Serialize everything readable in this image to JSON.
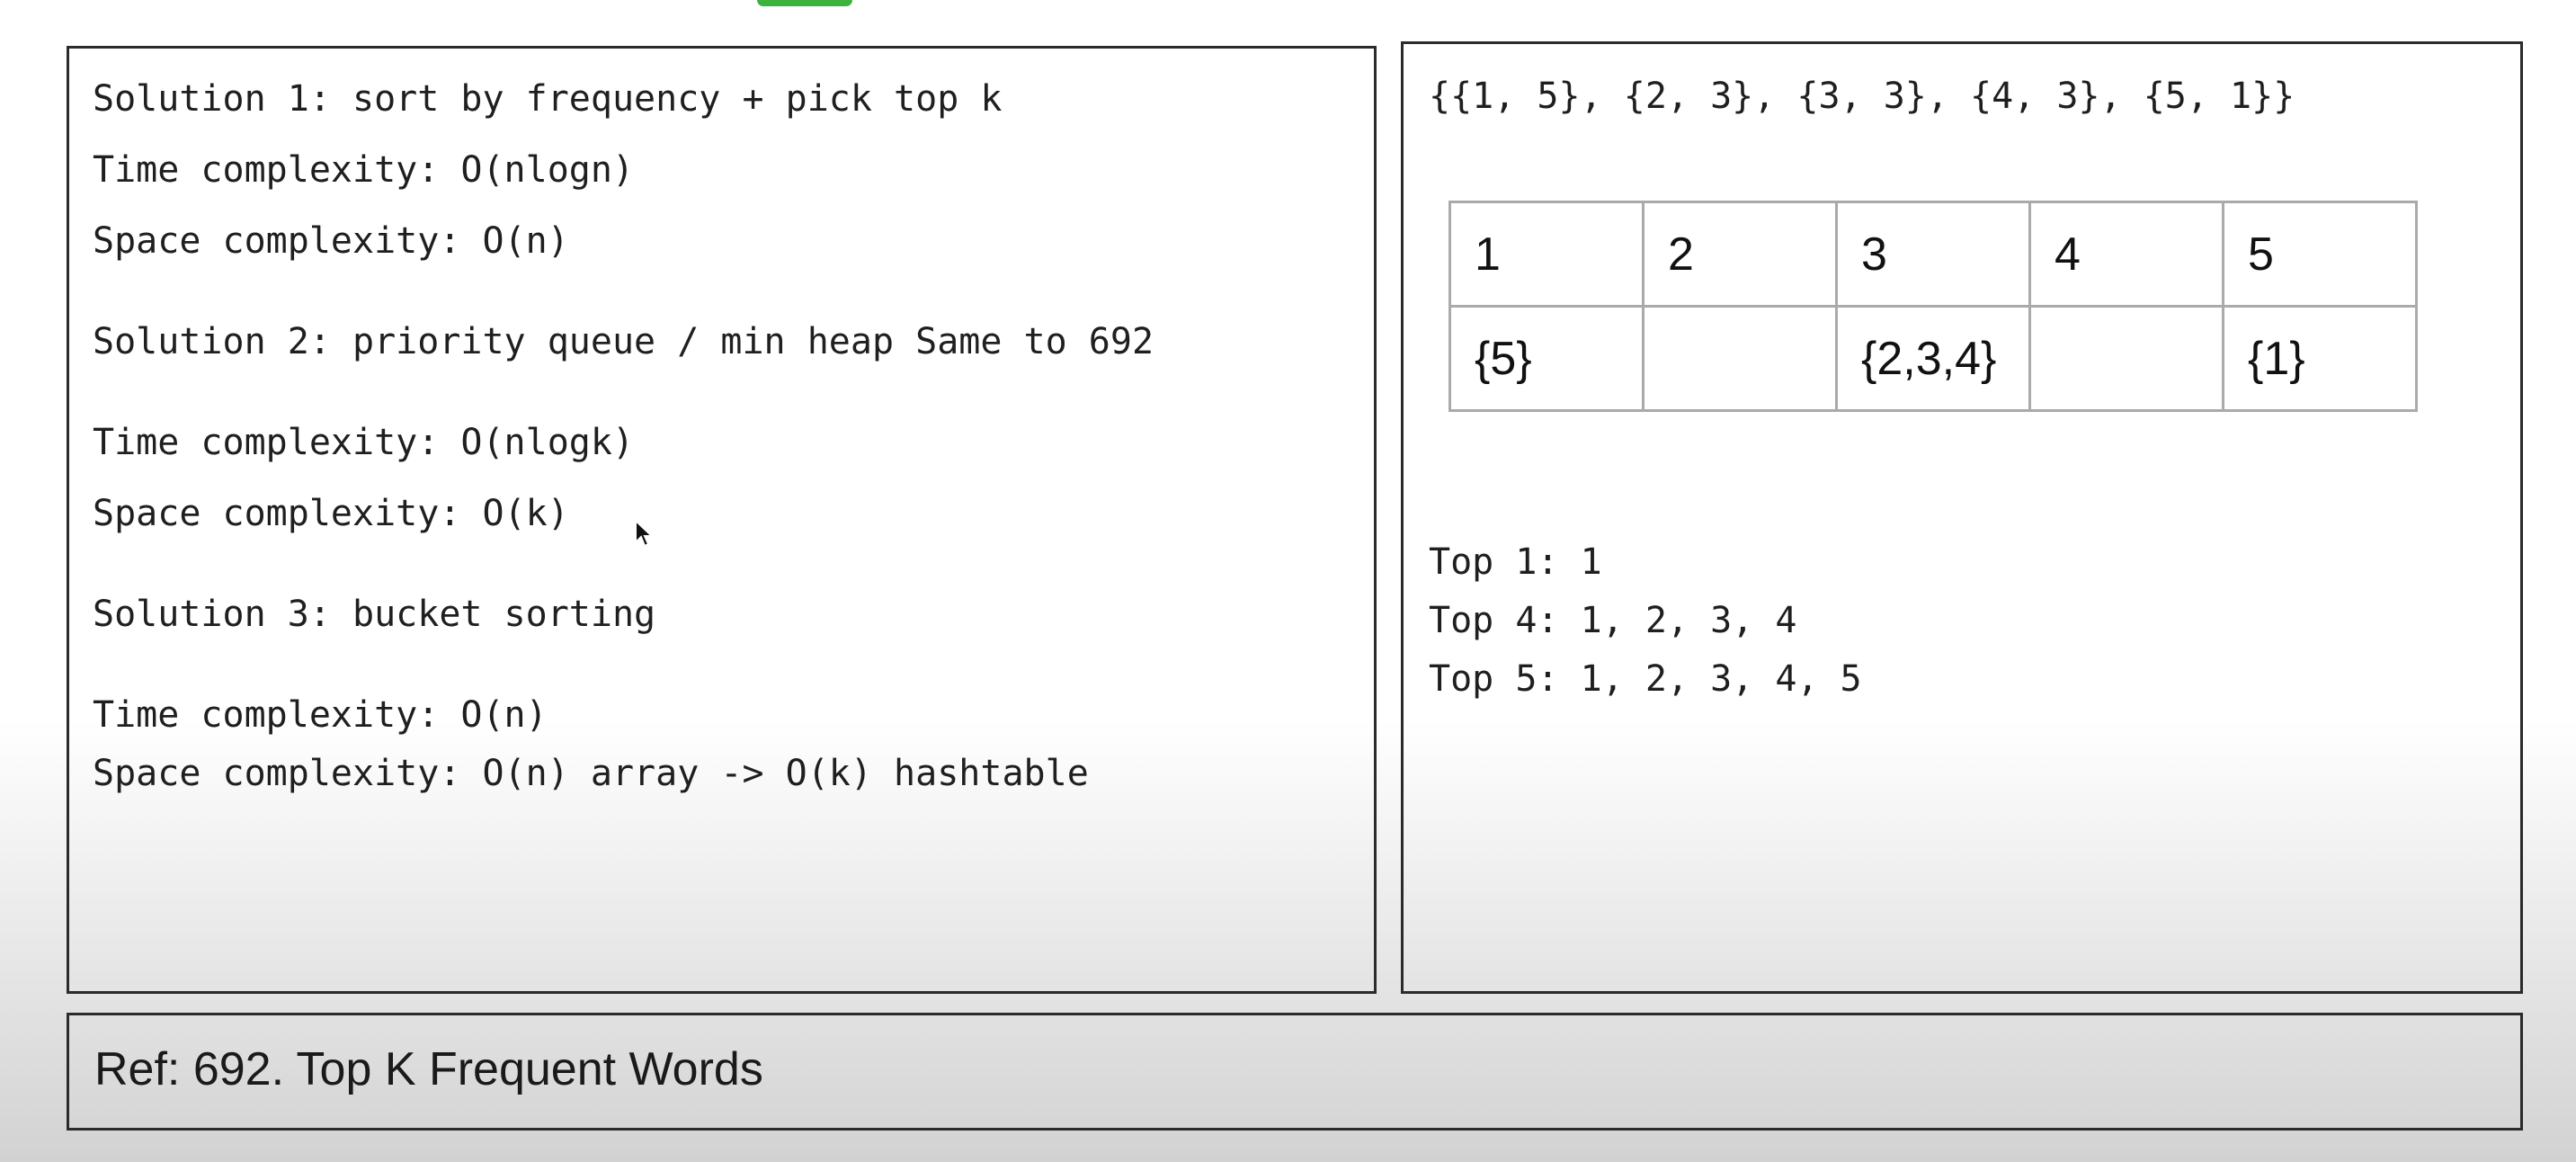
{
  "left_panel": {
    "lines": [
      "Solution 1: sort by frequency + pick top k",
      "Time complexity: O(nlogn)",
      "Space complexity: O(n)",
      "Solution 2: priority queue / min heap Same to 692",
      "Time complexity: O(nlogk)",
      "Space complexity: O(k)",
      "Solution 3: bucket sorting",
      "Time complexity: O(n)",
      "Space complexity: O(n) array -> O(k) hashtable"
    ]
  },
  "right_panel": {
    "pairs_text": "{{1, 5}, {2, 3}, {3, 3}, {4, 3}, {5, 1}}",
    "bucket_table": {
      "headers": [
        "1",
        "2",
        "3",
        "4",
        "5"
      ],
      "values": [
        "{5}",
        "",
        "{2,3,4}",
        "",
        "{1}"
      ]
    },
    "top_lines": [
      "Top 1: 1",
      "Top 4: 1, 2, 3, 4",
      "Top 5: 1, 2, 3, 4, 5"
    ]
  },
  "ref_panel": {
    "text": "Ref: 692. Top K Frequent Words"
  },
  "icons": {
    "cursor": "mouse-pointer-icon"
  },
  "colors": {
    "accent_tab": "#3db23d",
    "border": "#2b2b2b",
    "table_border": "#aaaaaa"
  }
}
